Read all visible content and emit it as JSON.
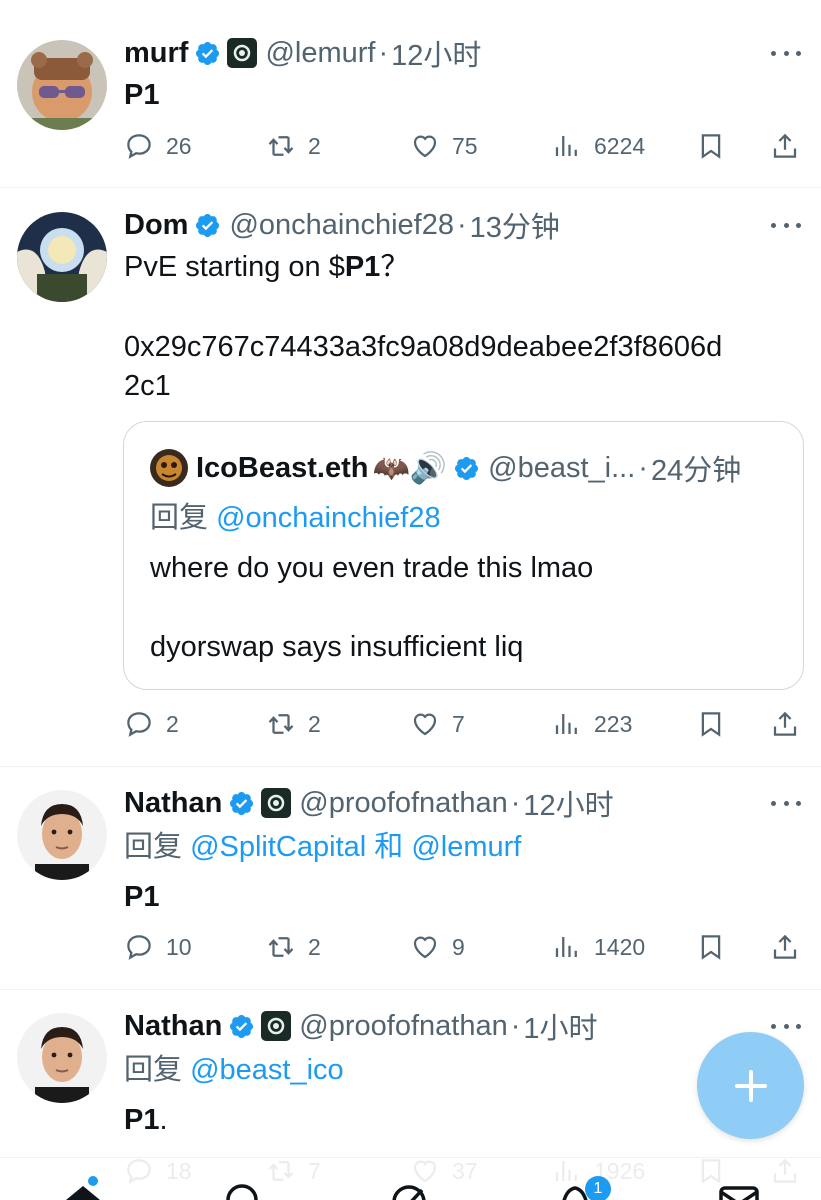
{
  "tweets": [
    {
      "name": "murf",
      "handle": "@lemurf",
      "separator": "·",
      "time": "12小时",
      "text": "P1",
      "stats": {
        "replies": "26",
        "reposts": "2",
        "likes": "75",
        "views": "6224"
      }
    },
    {
      "name": "Dom",
      "handle": "@onchainchief28",
      "separator": "·",
      "time": "13分钟",
      "text_prefix": "PvE starting on $",
      "text_bold": "P1",
      "text_suffix": "？",
      "text_line2": "0x29c767c74433a3fc9a08d9deabee2f3f8606d",
      "text_line3": "2c1",
      "quote": {
        "name": "IcoBeast.eth",
        "emojis": "🦇🔊",
        "handle": "@beast_i...",
        "separator": "·",
        "time": "24分钟",
        "reply_prefix": "回复",
        "reply_mention": "@onchainchief28",
        "line1": "where do you even trade this lmao",
        "line2": "dyorswap says insufficient liq"
      },
      "stats": {
        "replies": "2",
        "reposts": "2",
        "likes": "7",
        "views": "223"
      }
    },
    {
      "name": "Nathan",
      "handle": "@proofofnathan",
      "separator": "·",
      "time": "12小时",
      "reply_prefix": "回复",
      "reply_mention1": "@SplitCapital",
      "reply_and": "和",
      "reply_mention2": "@lemurf",
      "text": "P1",
      "stats": {
        "replies": "10",
        "reposts": "2",
        "likes": "9",
        "views": "1420"
      }
    },
    {
      "name": "Nathan",
      "handle": "@proofofnathan",
      "separator": "·",
      "time": "1小时",
      "reply_prefix": "回复",
      "reply_mention": "@beast_ico",
      "text_bold": "P1",
      "text_suffix": ".",
      "stats": {
        "replies": "18",
        "reposts": "7",
        "likes": "37",
        "views": "1926"
      }
    }
  ],
  "nav": {
    "notifications_badge": "1"
  },
  "colors": {
    "accent": "#1d9bf0",
    "text": "#0f1419",
    "secondary": "#536471",
    "fab": "#8fcdf7"
  }
}
